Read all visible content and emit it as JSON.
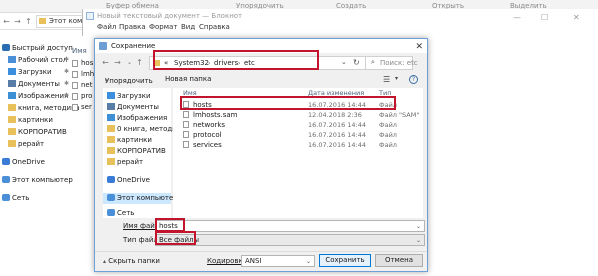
{
  "explorer": {
    "ribbon": [
      "Буфер обмена",
      "Упорядочить",
      "Создать",
      "Открыть",
      "Выделить"
    ],
    "address": "Этот компьютер",
    "nav": [
      {
        "label": "Быстрый доступ",
        "icon": "star-icon",
        "color": "#2b6cb0",
        "pinned": false
      },
      {
        "label": "Рабочий стол",
        "icon": "desktop-folder-icon",
        "color": "#4a90d9",
        "pinned": true
      },
      {
        "label": "Загрузки",
        "icon": "downloads-folder-icon",
        "color": "#3c8ede",
        "pinned": true
      },
      {
        "label": "Документы",
        "icon": "documents-folder-icon",
        "color": "#5a7da8",
        "pinned": true
      },
      {
        "label": "Изображения",
        "icon": "pictures-folder-icon",
        "color": "#3d8fd6",
        "pinned": true
      },
      {
        "label": "книга, методика",
        "icon": "folder-icon",
        "color": "#e8c15a",
        "pinned": false
      },
      {
        "label": "картинки",
        "icon": "folder-icon",
        "color": "#e8c15a",
        "pinned": false
      },
      {
        "label": "КОРПОРАТИВ",
        "icon": "folder-icon",
        "color": "#e8c15a",
        "pinned": false
      },
      {
        "label": "рерайт",
        "icon": "folder-icon",
        "color": "#e8c15a",
        "pinned": false
      },
      {
        "label": "OneDrive",
        "icon": "onedrive-icon",
        "color": "#3a7bd5",
        "pinned": false
      },
      {
        "label": "Этот компьютер",
        "icon": "computer-icon",
        "color": "#4a8fd8",
        "pinned": false
      },
      {
        "label": "Сеть",
        "icon": "network-icon",
        "color": "#4a8fd8",
        "pinned": false
      }
    ],
    "files": [
      "Имя",
      "hos",
      "lmh",
      "net",
      "pro",
      "ser"
    ]
  },
  "notepad": {
    "title": "Новый текстовый документ — Блокнот",
    "menu": [
      "Файл",
      "Правка",
      "Формат",
      "Вид",
      "Справка"
    ]
  },
  "dialog": {
    "title": "Сохранение",
    "breadcrumb": [
      "«",
      "System32",
      "drivers",
      "etc"
    ],
    "search_placeholder": "Поиск: etc",
    "organize": "Упорядочить",
    "new_folder": "Новая папка",
    "nav": [
      {
        "label": "Загрузки",
        "icon": "downloads-folder-icon",
        "color": "#3c8ede"
      },
      {
        "label": "Документы",
        "icon": "documents-folder-icon",
        "color": "#5a7da8"
      },
      {
        "label": "Изображения",
        "icon": "pictures-folder-icon",
        "color": "#3d8fd6"
      },
      {
        "label": "0 книга, методи",
        "icon": "folder-icon",
        "color": "#e8c15a"
      },
      {
        "label": "картинки",
        "icon": "folder-icon",
        "color": "#e8c15a"
      },
      {
        "label": "КОРПОРАТИВ",
        "icon": "folder-icon",
        "color": "#e8c15a"
      },
      {
        "label": "рерайт",
        "icon": "folder-icon",
        "color": "#e8c15a"
      },
      {
        "label": "OneDrive",
        "icon": "onedrive-icon",
        "color": "#3a7bd5"
      },
      {
        "label": "Этот компьютер",
        "icon": "computer-icon",
        "color": "#4a8fd8"
      },
      {
        "label": "Сеть",
        "icon": "network-icon",
        "color": "#4a8fd8"
      }
    ],
    "columns": {
      "name": "Имя",
      "date": "Дата изменения",
      "type": "Тип"
    },
    "files": [
      {
        "name": "hosts",
        "date": "16.07.2016 14:44",
        "type": "Файл"
      },
      {
        "name": "lmhosts.sam",
        "date": "12.04.2018 2:36",
        "type": "Файл \"SAM\""
      },
      {
        "name": "networks",
        "date": "16.07.2016 14:44",
        "type": "Файл"
      },
      {
        "name": "protocol",
        "date": "16.07.2016 14:44",
        "type": "Файл"
      },
      {
        "name": "services",
        "date": "16.07.2016 14:44",
        "type": "Файл"
      }
    ],
    "filename_label": "Имя файла:",
    "filename_value": "hosts",
    "filetype_label": "Тип файла:",
    "filetype_value": "Все файлы",
    "hide_folders": "Скрыть папки",
    "encoding_label": "Кодировка:",
    "encoding_value": "ANSI",
    "save": "Сохранить",
    "cancel": "Отмена"
  },
  "colors": {
    "highlight": "#c0152d",
    "accent": "#0078d7",
    "selection": "#cce8ff"
  }
}
